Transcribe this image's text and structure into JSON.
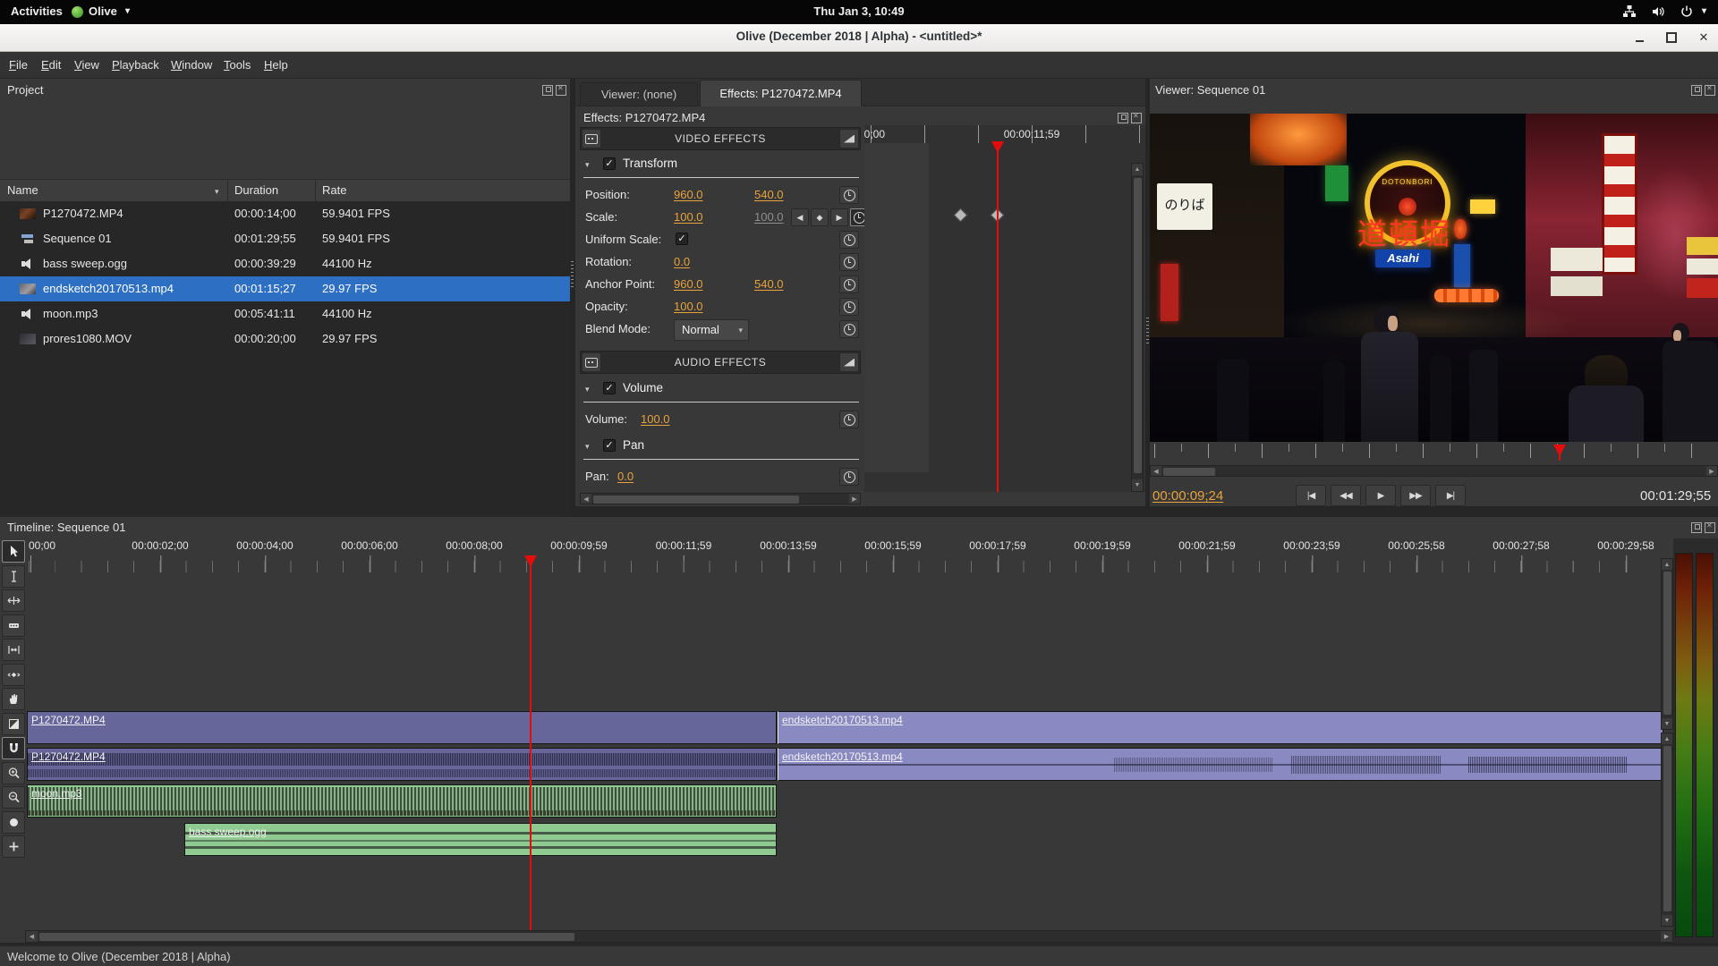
{
  "top_bar": {
    "activities_label": "Activities",
    "app_menu_label": "Olive",
    "clock": "Thu Jan 3, 10:49"
  },
  "title_bar": {
    "title": "Olive (December 2018 | Alpha) - <untitled>*"
  },
  "menu_bar": {
    "items": [
      "File",
      "Edit",
      "View",
      "Playback",
      "Window",
      "Tools",
      "Help"
    ]
  },
  "project_panel": {
    "title": "Project",
    "columns": {
      "name": "Name",
      "duration": "Duration",
      "rate": "Rate"
    },
    "rows": [
      {
        "name": "P1270472.MP4",
        "duration": "00:00:14;00",
        "rate": "59.9401 FPS"
      },
      {
        "name": "Sequence 01",
        "duration": "00:01:29;55",
        "rate": "59.9401 FPS"
      },
      {
        "name": "bass sweep.ogg",
        "duration": "00:00:39:29",
        "rate": "44100 Hz"
      },
      {
        "name": "endsketch20170513.mp4",
        "duration": "00:01:15;27",
        "rate": "29.97 FPS"
      },
      {
        "name": "moon.mp3",
        "duration": "00:05:41:11",
        "rate": "44100 Hz"
      },
      {
        "name": "prores1080.MOV",
        "duration": "00:00:20;00",
        "rate": "29.97 FPS"
      }
    ],
    "selected_row": "endsketch20170513.mp4"
  },
  "effects_panel": {
    "tabs": {
      "viewer": "Viewer: (none)",
      "effects": "Effects: P1270472.MP4"
    },
    "active_tab": "Effects: P1270472.MP4",
    "header": "Effects: P1270472.MP4",
    "video_effects_header": "VIDEO EFFECTS",
    "audio_effects_header": "AUDIO EFFECTS",
    "transform": {
      "title": "Transform",
      "position_label": "Position:",
      "position_x": "960.0",
      "position_y": "540.0",
      "scale_label": "Scale:",
      "scale_x": "100.0",
      "scale_y": "100.0",
      "uniform_scale_label": "Uniform Scale:",
      "rotation_label": "Rotation:",
      "rotation": "0.0",
      "anchor_label": "Anchor Point:",
      "anchor_x": "960.0",
      "anchor_y": "540.0",
      "opacity_label": "Opacity:",
      "opacity": "100.0",
      "blend_label": "Blend Mode:",
      "blend_mode": "Normal"
    },
    "volume": {
      "title": "Volume",
      "label": "Volume:",
      "value": "100.0"
    },
    "pan": {
      "title": "Pan",
      "label": "Pan:",
      "value": "0.0"
    },
    "keyframe_ruler": {
      "start_label": "00;00",
      "cursor_label": "00:00:11;59"
    }
  },
  "viewer_panel": {
    "title": "Viewer: Sequence 01",
    "current_timecode": "00:00:09;24",
    "duration_timecode": "00:01:29;55",
    "preview": {
      "dotonbori_sign": "DOTONBORI",
      "dotonbori_kanji": "道頓堀",
      "asahi_sign": "Asahi",
      "noriba_sign": "のりば"
    }
  },
  "timeline_panel": {
    "title": "Timeline: Sequence 01",
    "ruler_labels": [
      "00;00",
      "00:00:02;00",
      "00:00:04;00",
      "00:00:06;00",
      "00:00:08;00",
      "00:00:09;59",
      "00:00:11;59",
      "00:00:13;59",
      "00:00:15;59",
      "00:00:17;59",
      "00:00:19;59",
      "00:00:21;59",
      "00:00:23;59",
      "00:00:25;58",
      "00:00:27;58",
      "00:00:29;58"
    ],
    "tools": [
      "pointer",
      "edit",
      "ripple",
      "razor",
      "slip",
      "slide",
      "hand",
      "transition",
      "snapping",
      "zoom-in",
      "zoom-out",
      "record",
      "add"
    ],
    "clips": {
      "video1_a": "P1270472.MP4",
      "video1_b": "endsketch20170513.mp4",
      "audio1_a": "P1270472.MP4",
      "audio1_b": "endsketch20170513.mp4",
      "audio2_a": "moon.mp3",
      "audio3_a": "bass sweep.ogg"
    }
  },
  "status_bar": {
    "message": "Welcome to Olive (December 2018 | Alpha)"
  },
  "icons": {
    "app_menu_arrow": "▾",
    "tray_arrow": "▾",
    "sort_arrow": "▾",
    "collapse_arrow": "▾",
    "dropdown_arrow": "▾",
    "checkmark": "✓",
    "prev_keyframe": "◀",
    "keyframe_diamond": "◆",
    "next_keyframe": "▶",
    "transport_skip_start": "|◀",
    "transport_rewind": "◀◀",
    "transport_play": "▶",
    "transport_fast_forward": "▶▶",
    "transport_skip_end": "▶|",
    "scroll_left": "◀",
    "scroll_right": "▶",
    "scroll_up": "▲",
    "scroll_down": "▼",
    "window_close": "✕",
    "panel_close": "✕"
  },
  "colors": {
    "value_link_orange": "#e8a33c",
    "selection_blue": "#2d6fc2",
    "playhead_red": "#e60c0c",
    "clip_purple": "#66669b",
    "clip_light_purple": "#8a8ac2",
    "clip_green": "#8fcb90"
  }
}
